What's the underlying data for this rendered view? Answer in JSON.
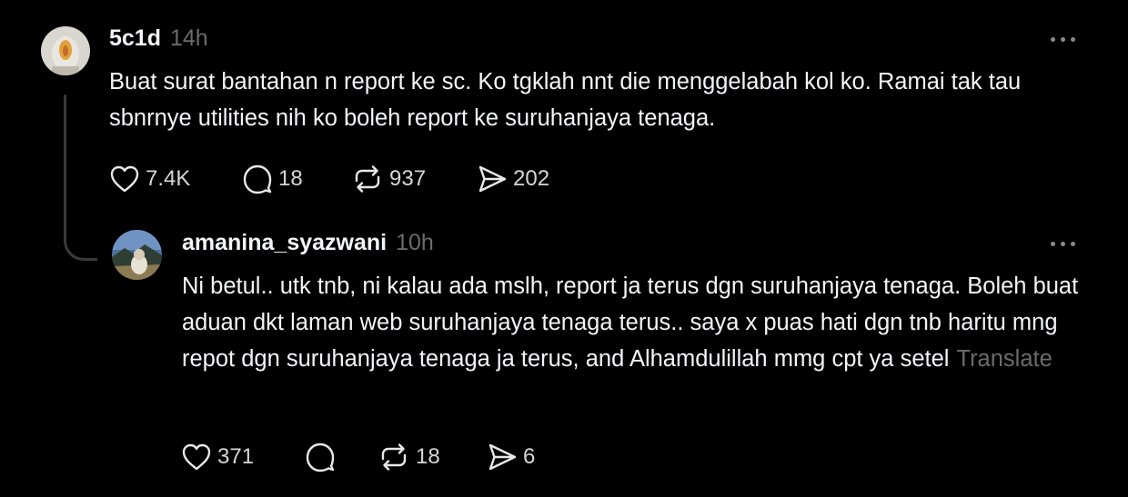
{
  "post": {
    "username": "5c1d",
    "time": "14h",
    "text": "Buat surat bantahan n report ke sc. Ko tgklah nnt die menggelabah kol ko. Ramai tak tau sbnrnye utilities nih ko boleh report ke suruhanjaya tenaga.",
    "likes": "7.4K",
    "replies": "18",
    "reposts": "937",
    "shares": "202"
  },
  "reply": {
    "username": "amanina_syazwani",
    "time": "10h",
    "text": "Ni betul.. utk tnb, ni kalau ada mslh, report ja terus dgn suruhanjaya tenaga. Boleh buat aduan dkt laman web suruhanjaya tenaga terus.. saya x puas hati dgn tnb haritu mng repot dgn suruhanjaya tenaga ja terus, and Alhamdulillah mmg cpt ya setel",
    "translate_label": "Translate",
    "likes": "371",
    "reposts": "18",
    "shares": "6"
  },
  "colors": {
    "background": "#000000",
    "primary_text": "#f3f5f7",
    "secondary_text": "#6b6b6b",
    "thread_line": "#3a3a3a"
  },
  "icons": [
    "heart-icon",
    "comment-icon",
    "repost-icon",
    "share-icon",
    "more-icon"
  ]
}
